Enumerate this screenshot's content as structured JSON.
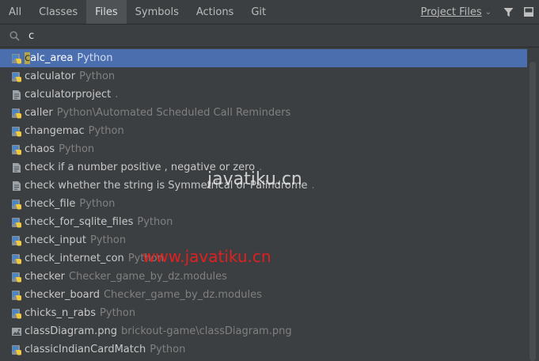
{
  "tabs": [
    "All",
    "Classes",
    "Files",
    "Symbols",
    "Actions",
    "Git"
  ],
  "scope": {
    "label": "Project Files"
  },
  "icons": {
    "filter": "filter-icon",
    "window": "window-icon",
    "search": "search-icon",
    "python": "python-file-icon",
    "text": "text-file-icon",
    "image": "image-file-icon"
  },
  "search": {
    "value": "c"
  },
  "results": [
    {
      "name": "calc_area",
      "location": "Python",
      "icon": "python",
      "selected": true
    },
    {
      "name": "calculator",
      "location": "Python",
      "icon": "python"
    },
    {
      "name": "calculatorproject",
      "location": ".",
      "icon": "text"
    },
    {
      "name": "caller",
      "location": "Python\\Automated Scheduled Call Reminders",
      "icon": "python"
    },
    {
      "name": "changemac",
      "location": "Python",
      "icon": "python"
    },
    {
      "name": "chaos",
      "location": "Python",
      "icon": "python"
    },
    {
      "name": "check  if a number positive , negative or zero",
      "location": ".",
      "icon": "text"
    },
    {
      "name": "check whether the string is Symmetrical or Palindrome",
      "location": ".",
      "icon": "text"
    },
    {
      "name": "check_file",
      "location": "Python",
      "icon": "python"
    },
    {
      "name": "check_for_sqlite_files",
      "location": "Python",
      "icon": "python"
    },
    {
      "name": "check_input",
      "location": "Python",
      "icon": "python"
    },
    {
      "name": "check_internet_con",
      "location": "Python",
      "icon": "python"
    },
    {
      "name": "checker",
      "location": "Checker_game_by_dz.modules",
      "icon": "python"
    },
    {
      "name": "checker_board",
      "location": "Checker_game_by_dz.modules",
      "icon": "python"
    },
    {
      "name": "chicks_n_rabs",
      "location": "Python",
      "icon": "python"
    },
    {
      "name": "classDiagram.png",
      "location": "brickout-game\\classDiagram.png",
      "icon": "image"
    },
    {
      "name": "classicIndianCardMatch",
      "location": "Python",
      "icon": "python"
    }
  ],
  "watermarks": [
    "javatiku.cn",
    "www.javatiku.cn"
  ]
}
